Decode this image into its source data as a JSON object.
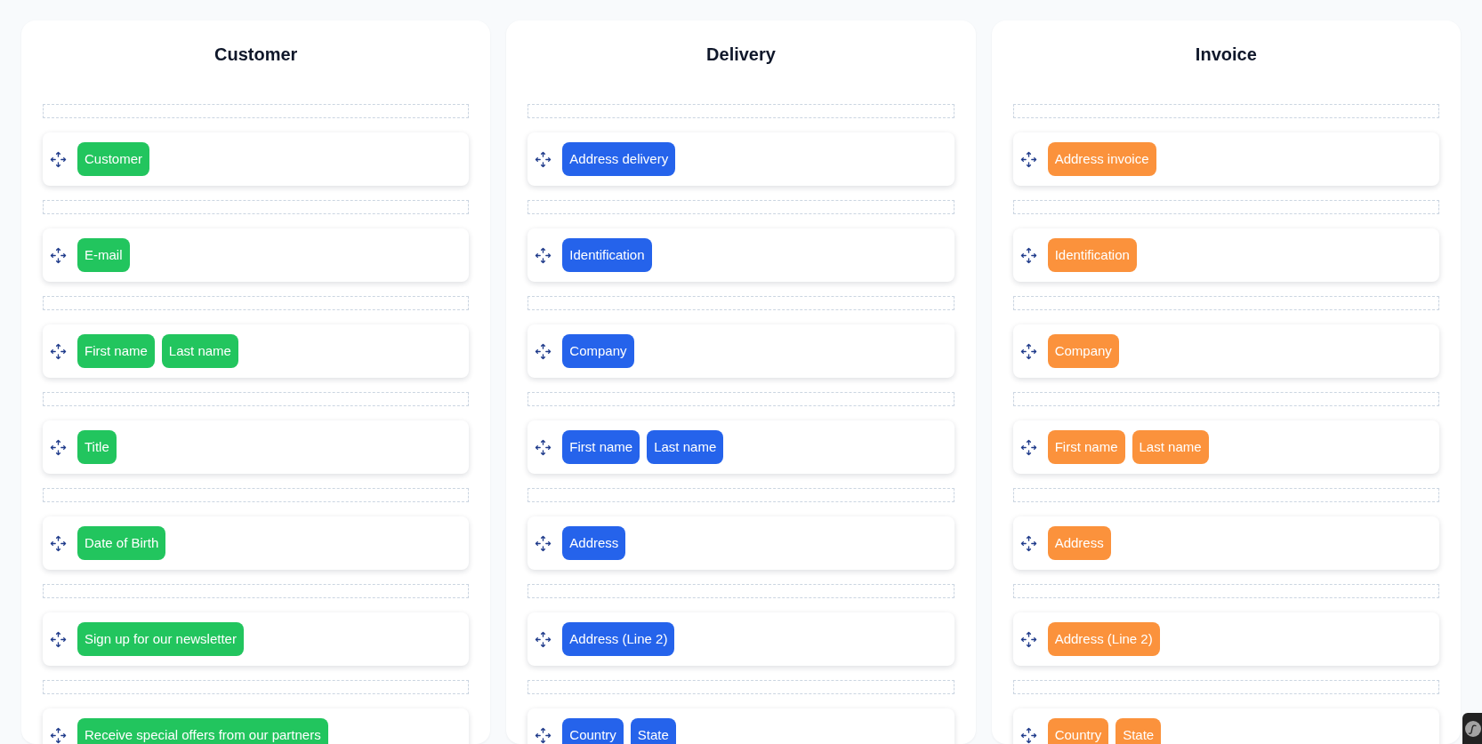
{
  "columns": [
    {
      "title": "Customer",
      "color": "#22c55e",
      "rows": [
        {
          "fields": [
            "Customer"
          ]
        },
        {
          "fields": [
            "E-mail"
          ]
        },
        {
          "fields": [
            "First name",
            "Last name"
          ]
        },
        {
          "fields": [
            "Title"
          ]
        },
        {
          "fields": [
            "Date of Birth"
          ]
        },
        {
          "fields": [
            "Sign up for our newsletter"
          ]
        },
        {
          "fields": [
            "Receive special offers from our partners"
          ]
        }
      ]
    },
    {
      "title": "Delivery",
      "color": "#2563eb",
      "rows": [
        {
          "fields": [
            "Address delivery"
          ]
        },
        {
          "fields": [
            "Identification"
          ]
        },
        {
          "fields": [
            "Company"
          ]
        },
        {
          "fields": [
            "First name",
            "Last name"
          ]
        },
        {
          "fields": [
            "Address"
          ]
        },
        {
          "fields": [
            "Address (Line 2)"
          ]
        },
        {
          "fields": [
            "Country",
            "State"
          ]
        }
      ]
    },
    {
      "title": "Invoice",
      "color": "#fb923c",
      "rows": [
        {
          "fields": [
            "Address invoice"
          ]
        },
        {
          "fields": [
            "Identification"
          ]
        },
        {
          "fields": [
            "Company"
          ]
        },
        {
          "fields": [
            "First name",
            "Last name"
          ]
        },
        {
          "fields": [
            "Address"
          ]
        },
        {
          "fields": [
            "Address (Line 2)"
          ]
        },
        {
          "fields": [
            "Country",
            "State"
          ]
        }
      ]
    }
  ]
}
